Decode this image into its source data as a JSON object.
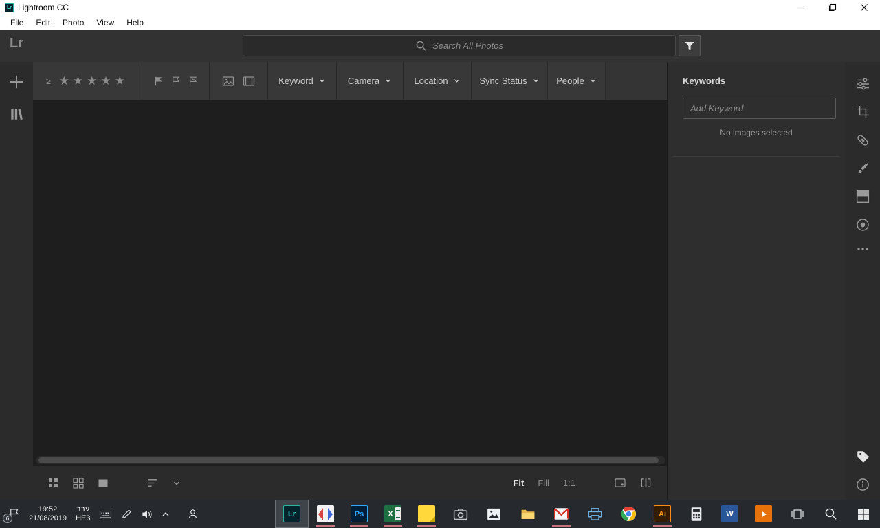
{
  "window": {
    "icon_label": "Lr",
    "title": "Lightroom CC",
    "menu": [
      "File",
      "Edit",
      "Photo",
      "View",
      "Help"
    ]
  },
  "topbar": {
    "logo": "Lr",
    "search_placeholder": "Search All Photos"
  },
  "filterbar": {
    "rating_prefix": "≥",
    "stars": "★★★★★",
    "dropdowns": [
      {
        "label": "Keyword"
      },
      {
        "label": "Camera"
      },
      {
        "label": "Location"
      },
      {
        "label": "Sync Status"
      },
      {
        "label": "People"
      }
    ]
  },
  "right_panel": {
    "title": "Keywords",
    "input_placeholder": "Add Keyword",
    "empty_text": "No images selected"
  },
  "bottom_toolbar": {
    "zoom": [
      "Fit",
      "Fill",
      "1:1"
    ],
    "active_zoom": "Fit"
  },
  "taskbar": {
    "time": "19:52",
    "date": "21/08/2019",
    "lang_line1": "עבר",
    "lang_line2": "HE3",
    "notification_badge": "6",
    "apps": [
      {
        "name": "lightroom",
        "glyph": "Lr",
        "state": "active"
      },
      {
        "name": "paint",
        "state": "running"
      },
      {
        "name": "photoshop",
        "glyph": "Ps",
        "state": "running"
      },
      {
        "name": "excel",
        "glyph": "X",
        "state": "running"
      },
      {
        "name": "sticky-notes",
        "state": "running"
      },
      {
        "name": "camera"
      },
      {
        "name": "photos"
      },
      {
        "name": "file-explorer"
      },
      {
        "name": "mail",
        "state": "running"
      },
      {
        "name": "printer"
      },
      {
        "name": "chrome"
      },
      {
        "name": "illustrator",
        "glyph": "Ai",
        "state": "running"
      },
      {
        "name": "calculator"
      },
      {
        "name": "word",
        "glyph": "W"
      },
      {
        "name": "video-player"
      }
    ]
  },
  "colors": {
    "lightroom_accent": "#3fd6c5",
    "photoshop_accent": "#31a8ff",
    "illustrator_accent": "#ff9a1e",
    "excel_green": "#1d6f42",
    "word_blue": "#2b579a",
    "running_underline": "#c9707b",
    "chrome_dark_gray": "#323232",
    "content_dark": "#1e1e1e"
  }
}
